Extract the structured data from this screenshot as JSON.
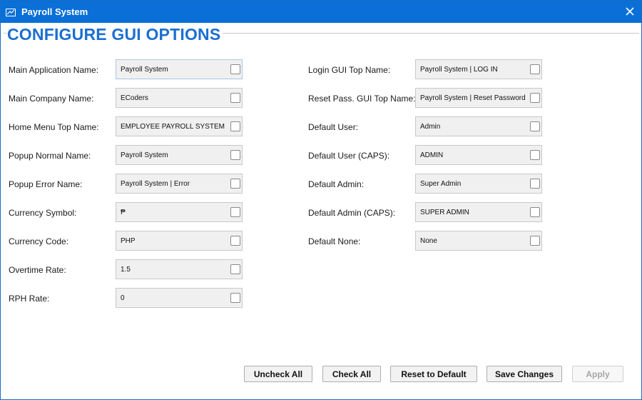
{
  "window": {
    "title": "Payroll System"
  },
  "page": {
    "heading": "CONFIGURE GUI OPTIONS"
  },
  "left_fields": [
    {
      "label": "Main Application Name:",
      "value": "Payroll System"
    },
    {
      "label": "Main Company Name:",
      "value": "ECoders"
    },
    {
      "label": "Home Menu Top Name:",
      "value": "EMPLOYEE PAYROLL SYSTEM"
    },
    {
      "label": "Popup Normal Name:",
      "value": "Payroll System"
    },
    {
      "label": "Popup Error Name:",
      "value": "Payroll System | Error"
    },
    {
      "label": "Currency Symbol:",
      "value": "₱"
    },
    {
      "label": "Currency Code:",
      "value": "PHP"
    },
    {
      "label": "Overtime Rate:",
      "value": "1.5"
    },
    {
      "label": "RPH Rate:",
      "value": "0"
    }
  ],
  "right_fields": [
    {
      "label": "Login GUI Top Name:",
      "value": "Payroll System | LOG IN"
    },
    {
      "label": "Reset Pass. GUI Top Name:",
      "value": "Payroll System | Reset Password"
    },
    {
      "label": "Default User:",
      "value": "Admin"
    },
    {
      "label": "Default User (CAPS):",
      "value": "ADMIN"
    },
    {
      "label": "Default Admin:",
      "value": "Super Admin"
    },
    {
      "label": "Default Admin (CAPS):",
      "value": "SUPER ADMIN"
    },
    {
      "label": "Default None:",
      "value": "None"
    }
  ],
  "buttons": {
    "uncheck_all": "Uncheck All",
    "check_all": "Check All",
    "reset_default": "Reset to Default",
    "save_changes": "Save Changes",
    "apply": "Apply"
  },
  "colors": {
    "titlebar": "#0a6fd6",
    "heading": "#1b6fd0"
  },
  "icons": {
    "app": "payroll-app-icon",
    "close": "close-icon",
    "checkbox": "checkbox-unchecked"
  }
}
